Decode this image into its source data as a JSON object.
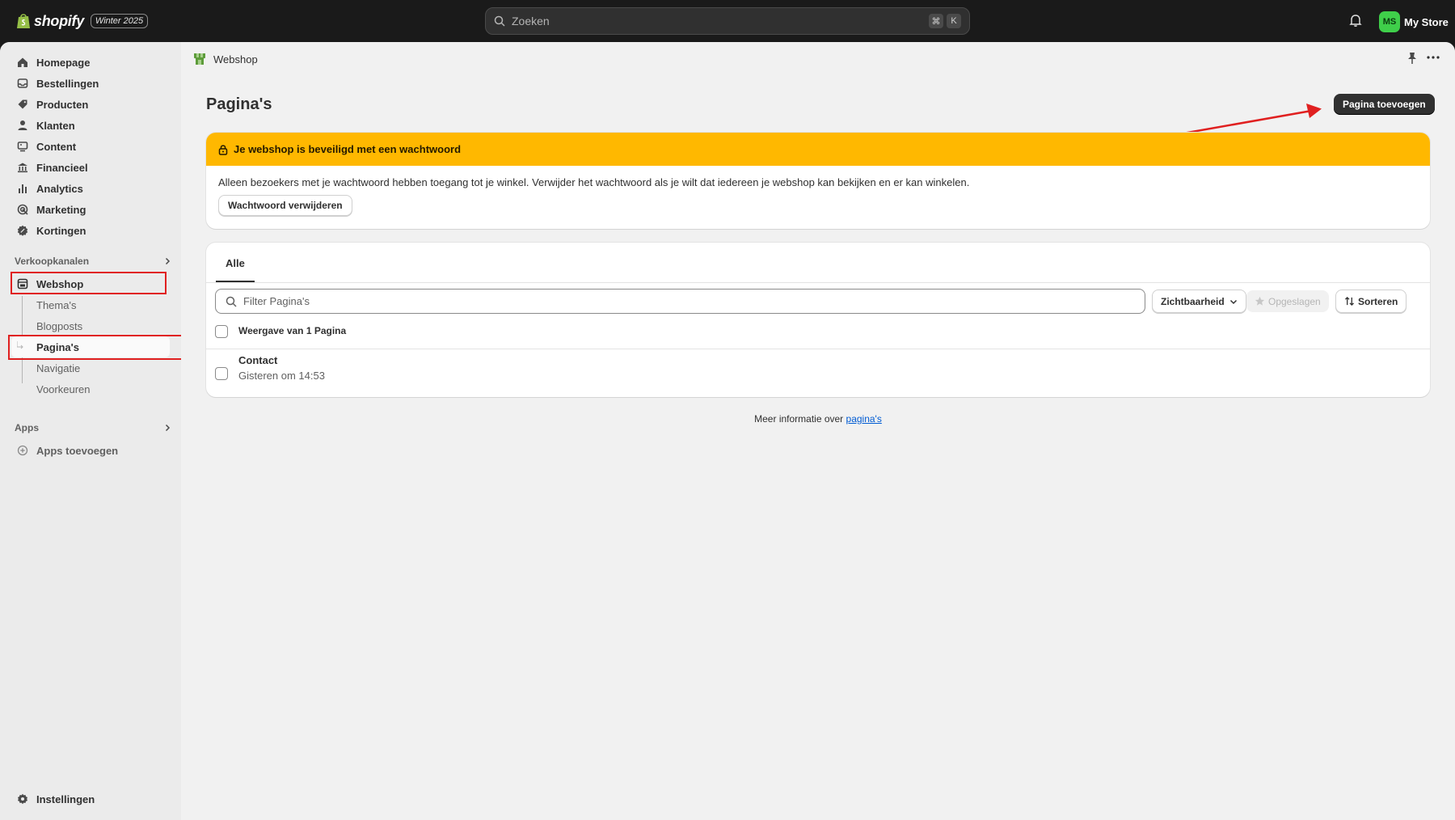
{
  "topbar": {
    "brand": "shopify",
    "badge": "Winter 2025",
    "search_placeholder": "Zoeken",
    "shortcut_keys": [
      "⌘",
      "K"
    ],
    "avatar_initials": "MS",
    "store_name": "My Store"
  },
  "sidebar": {
    "items": [
      {
        "label": "Homepage",
        "icon": "home-icon"
      },
      {
        "label": "Bestellingen",
        "icon": "inbox-icon"
      },
      {
        "label": "Producten",
        "icon": "tag-icon"
      },
      {
        "label": "Klanten",
        "icon": "person-icon"
      },
      {
        "label": "Content",
        "icon": "content-icon"
      },
      {
        "label": "Financieel",
        "icon": "bank-icon"
      },
      {
        "label": "Analytics",
        "icon": "bar-chart-icon"
      },
      {
        "label": "Marketing",
        "icon": "target-icon"
      },
      {
        "label": "Kortingen",
        "icon": "discount-icon"
      }
    ],
    "sales_channels_heading": "Verkoopkanalen",
    "webshop_label": "Webshop",
    "webshop_sub": [
      "Thema's",
      "Blogposts",
      "Pagina's",
      "Navigatie",
      "Voorkeuren"
    ],
    "apps_heading": "Apps",
    "add_apps_label": "Apps toevoegen",
    "settings_label": "Instellingen"
  },
  "header": {
    "breadcrumb": "Webshop",
    "title": "Pagina's",
    "add_page_button": "Pagina toevoegen"
  },
  "banner": {
    "title": "Je webshop is beveiligd met een wachtwoord",
    "text": "Alleen bezoekers met je wachtwoord hebben toegang tot je winkel. Verwijder het wachtwoord als je wilt dat iedereen je webshop kan bekijken en er kan winkelen.",
    "button": "Wachtwoord verwijderen",
    "color": "#ffb800"
  },
  "list": {
    "tab": "Alle",
    "filter_placeholder": "Filter Pagina's",
    "visibility_button": "Zichtbaarheid",
    "saved_button": "Opgeslagen",
    "sort_button": "Sorteren",
    "count_text": "Weergave van 1 Pagina",
    "rows": [
      {
        "title": "Contact",
        "subtitle": "Gisteren om 14:53"
      }
    ]
  },
  "footer": {
    "text": "Meer informatie over ",
    "link": "pagina's"
  }
}
